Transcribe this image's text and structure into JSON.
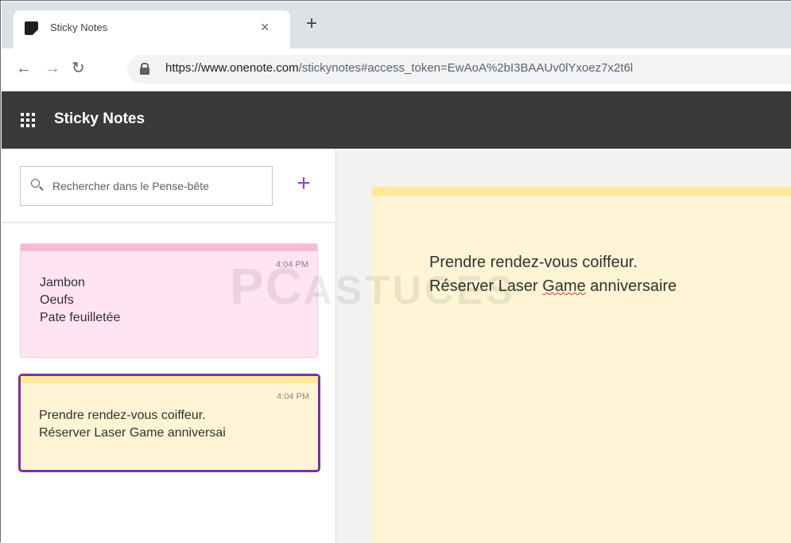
{
  "browser": {
    "tab_title": "Sticky Notes",
    "tab_close": "×",
    "new_tab": "+",
    "url_host": "https://www.onenote.com",
    "url_path": "/stickynotes#access_token=EwAoA%2bI3BAAUv0lYxoez7x2t6l"
  },
  "app": {
    "title": "Sticky Notes"
  },
  "sidebar": {
    "search_placeholder": "Rechercher dans le Pense-bête",
    "add_label": "+",
    "notes": [
      {
        "time": "4:04 PM",
        "color": "#ffe4f1",
        "lines": [
          "Jambon",
          "Oeufs",
          "Pate feuilletée"
        ]
      },
      {
        "time": "4:04 PM",
        "color": "#fff5d6",
        "selected": true,
        "lines": [
          "Prendre rendez-vous coiffeur.",
          "Réserver Laser Game anniversai"
        ]
      }
    ]
  },
  "editor": {
    "line1": "Prendre rendez-vous coiffeur.",
    "line2_before": "Réserver Laser ",
    "line2_misspelled": "Game",
    "line2_after": " anniversaire"
  },
  "watermark": {
    "part1": "PC",
    "part2": "ASTUCES"
  },
  "colors": {
    "accent": "#7b2fa8",
    "appbar": "#3b3a39",
    "note_yellow": "#fff5d6",
    "note_pink": "#ffe4f1"
  }
}
